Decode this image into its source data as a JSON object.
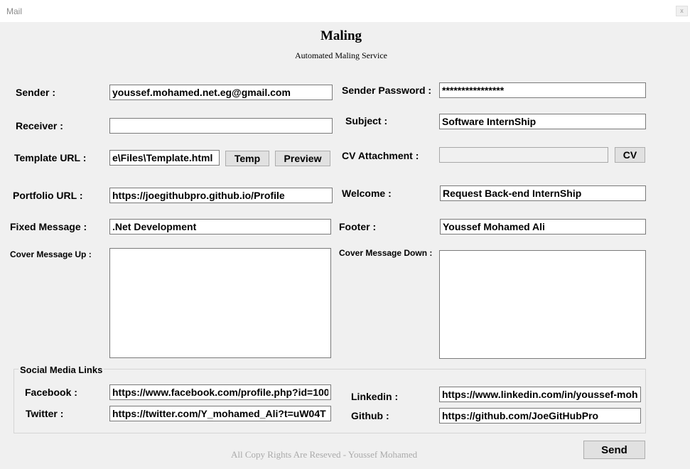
{
  "window": {
    "title": "Mail",
    "close_label": "x"
  },
  "header": {
    "title": "Maling",
    "subtitle": "Automated Maling Service"
  },
  "form": {
    "sender": {
      "label": "Sender :",
      "value": "youssef.mohamed.net.eg@gmail.com"
    },
    "sender_password": {
      "label": "Sender Password :",
      "value": "****************"
    },
    "receiver": {
      "label": "Receiver :",
      "value": ""
    },
    "subject": {
      "label": "Subject :",
      "value": "Software InternShip"
    },
    "template_url": {
      "label": "Template URL :",
      "value": "e\\Files\\Template.html"
    },
    "cv_attachment": {
      "label": "CV Attachment :",
      "value": ""
    },
    "portfolio_url": {
      "label": "Portfolio URL :",
      "value": "https://joegithubpro.github.io/Profile"
    },
    "welcome": {
      "label": "Welcome :",
      "value": "Request Back-end InternShip"
    },
    "fixed_message": {
      "label": "Fixed Message :",
      "value": ".Net Development"
    },
    "footer": {
      "label": "Footer  :",
      "value": "Youssef Mohamed Ali"
    },
    "cover_message_up": {
      "label": "Cover Message Up :",
      "value": ""
    },
    "cover_message_down": {
      "label": "Cover Message Down :",
      "value": ""
    }
  },
  "buttons": {
    "temp": "Temp",
    "preview": "Preview",
    "cv": "CV",
    "send": "Send"
  },
  "social": {
    "legend": "Social Media Links",
    "facebook": {
      "label": "Facebook :",
      "value": "https://www.facebook.com/profile.php?id=100"
    },
    "twitter": {
      "label": "Twitter :",
      "value": "https://twitter.com/Y_mohamed_Ali?t=uW04T"
    },
    "linkedin": {
      "label": "Linkedin :",
      "value": "https://www.linkedin.com/in/youssef-moh"
    },
    "github": {
      "label": "Github :",
      "value": "https://github.com/JoeGitHubPro"
    }
  },
  "copyright": "All Copy Rights  Are Reseved  - Youssef Mohamed"
}
